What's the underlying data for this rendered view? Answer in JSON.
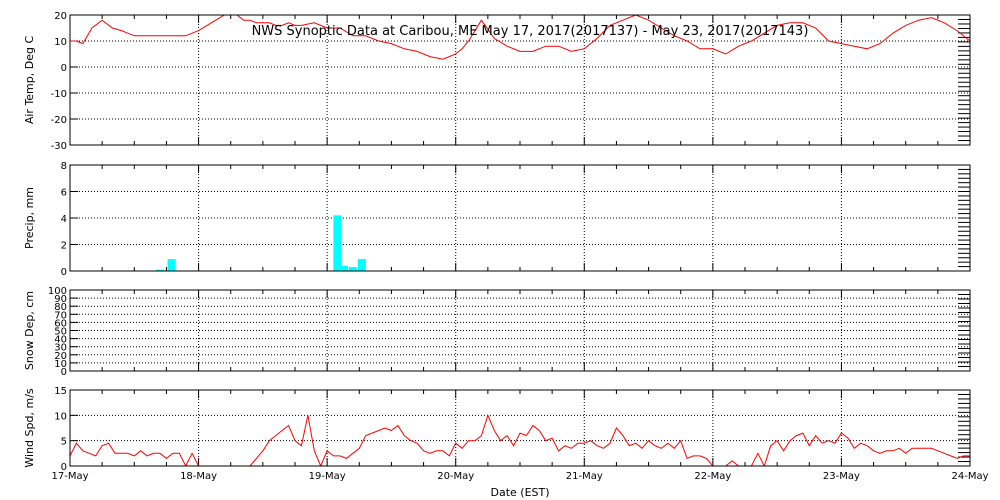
{
  "chart_data": {
    "title": "NWS Synoptic Data at Caribou, ME   May 17, 2017(2017137) - May 23, 2017(2017143)",
    "xlabel": "Date (EST)",
    "x_ticks": [
      "17-May",
      "18-May",
      "19-May",
      "20-May",
      "21-May",
      "22-May",
      "23-May",
      "24-May"
    ],
    "x_range": [
      "2017-05-17 00:00",
      "2017-05-24 00:00"
    ],
    "panels": [
      {
        "id": "air-temp",
        "type": "line",
        "ylabel": "Air Temp, Deg C",
        "ylim": [
          -30,
          20
        ],
        "yticks": [
          -30,
          -20,
          -10,
          0,
          10,
          20
        ],
        "color": "#ff0000",
        "series": [
          {
            "x": [
              0,
              0.05,
              0.1,
              0.17,
              0.25,
              0.33,
              0.4,
              0.5,
              0.6,
              0.75,
              0.9,
              1.0,
              1.1,
              1.2,
              1.3,
              1.35,
              1.4,
              1.45,
              1.5,
              1.55,
              1.6,
              1.65,
              1.7,
              1.75,
              1.8,
              1.9,
              2.0,
              2.1,
              2.2,
              2.3,
              2.4,
              2.5,
              2.6,
              2.7,
              2.8,
              2.9,
              3.0,
              3.05,
              3.1,
              3.15,
              3.2,
              3.3,
              3.4,
              3.5,
              3.6,
              3.7,
              3.8,
              3.9,
              4.0,
              4.1,
              4.2,
              4.3,
              4.4,
              4.5,
              4.6,
              4.7,
              4.8,
              4.9,
              5.0,
              5.1,
              5.2,
              5.3,
              5.4,
              5.5,
              5.6,
              5.7,
              5.8,
              5.9,
              6.0,
              6.1,
              6.2,
              6.3,
              6.4,
              6.5,
              6.6,
              6.7,
              6.8,
              6.9,
              7.0
            ],
            "y": [
              10,
              10,
              9,
              15,
              18,
              15,
              14,
              12,
              12,
              12,
              12,
              14,
              17,
              20,
              20,
              18,
              18,
              17,
              17,
              17,
              16,
              16,
              17,
              16,
              16,
              17,
              15,
              15,
              12,
              12,
              10,
              9,
              7,
              6,
              4,
              3,
              5,
              7,
              10,
              14,
              18,
              11,
              8,
              6,
              6,
              8,
              8,
              6,
              7,
              11,
              16,
              18,
              20,
              18,
              15,
              12,
              10,
              7,
              7,
              5,
              8,
              10,
              13,
              16,
              17,
              17,
              15,
              10,
              9,
              8,
              7,
              9,
              13,
              16,
              18,
              19,
              17,
              14,
              10
            ]
          }
        ]
      },
      {
        "id": "precip",
        "type": "bar",
        "ylabel": "Precip, mm",
        "ylim": [
          0,
          8
        ],
        "yticks": [
          0,
          2,
          4,
          6,
          8
        ],
        "color": "#00ffff",
        "bars": [
          {
            "x": 0.7,
            "value": 0.1
          },
          {
            "x": 0.79,
            "value": 0.9
          },
          {
            "x": 2.08,
            "value": 4.2
          },
          {
            "x": 2.13,
            "value": 0.4
          },
          {
            "x": 2.2,
            "value": 0.3
          },
          {
            "x": 2.27,
            "value": 0.9
          }
        ]
      },
      {
        "id": "snow-dep",
        "type": "line",
        "ylabel": "Snow Dep, cm",
        "ylim": [
          0,
          100
        ],
        "yticks": [
          0,
          10,
          20,
          30,
          40,
          50,
          60,
          70,
          80,
          90,
          100
        ],
        "color": "#ff0000",
        "series": []
      },
      {
        "id": "wind-spd",
        "type": "line",
        "ylabel": "Wind Spd, m/s",
        "ylim": [
          0,
          15
        ],
        "yticks": [
          0,
          5,
          10,
          15
        ],
        "color": "#ff0000",
        "series": [
          {
            "x": [
              0,
              0.05,
              0.1,
              0.15,
              0.2,
              0.25,
              0.3,
              0.35,
              0.4,
              0.45,
              0.5,
              0.55,
              0.6,
              0.65,
              0.7,
              0.75,
              0.8,
              0.85,
              0.9,
              0.95,
              1.0,
              1.05,
              1.1,
              1.15,
              1.2,
              1.25,
              1.3,
              1.35,
              1.4,
              1.45,
              1.5,
              1.55,
              1.6,
              1.65,
              1.7,
              1.75,
              1.8,
              1.85,
              1.9,
              1.95,
              2.0,
              2.05,
              2.1,
              2.15,
              2.2,
              2.25,
              2.3,
              2.35,
              2.4,
              2.45,
              2.5,
              2.55,
              2.6,
              2.65,
              2.7,
              2.75,
              2.8,
              2.85,
              2.9,
              2.95,
              3.0,
              3.05,
              3.1,
              3.15,
              3.2,
              3.25,
              3.3,
              3.35,
              3.4,
              3.45,
              3.5,
              3.55,
              3.6,
              3.65,
              3.7,
              3.75,
              3.8,
              3.85,
              3.9,
              3.95,
              4.0,
              4.05,
              4.1,
              4.15,
              4.2,
              4.25,
              4.3,
              4.35,
              4.4,
              4.45,
              4.5,
              4.55,
              4.6,
              4.65,
              4.7,
              4.75,
              4.8,
              4.85,
              4.9,
              4.95,
              5.0,
              5.05,
              5.1,
              5.15,
              5.2,
              5.25,
              5.3,
              5.35,
              5.4,
              5.45,
              5.5,
              5.55,
              5.6,
              5.65,
              5.7,
              5.75,
              5.8,
              5.85,
              5.9,
              5.95,
              6.0,
              6.05,
              6.1,
              6.15,
              6.2,
              6.25,
              6.3,
              6.35,
              6.4,
              6.45,
              6.5,
              6.55,
              6.6,
              6.65,
              6.7,
              6.75,
              6.8,
              6.85,
              6.9,
              6.95,
              7.0
            ],
            "y": [
              2,
              4.5,
              3,
              2.5,
              2,
              4,
              4.5,
              2.5,
              2.5,
              2.5,
              2,
              3,
              2,
              2.5,
              2.5,
              1.5,
              2.5,
              2.5,
              0,
              2.5,
              0,
              0,
              0,
              0,
              0,
              0,
              0,
              0,
              0,
              1.5,
              3,
              5,
              6,
              7,
              8,
              5,
              4,
              10,
              3,
              0,
              3,
              2,
              2,
              1.5,
              2.5,
              3.5,
              6,
              6.5,
              7,
              7.5,
              7,
              8,
              6,
              5,
              4.5,
              3,
              2.5,
              3,
              3,
              2,
              4.5,
              3.5,
              5,
              5,
              6,
              10,
              7,
              5,
              6,
              4,
              6.5,
              6,
              8,
              7,
              5,
              5.5,
              3,
              4,
              3.5,
              4.5,
              4.5,
              5,
              4,
              3.5,
              4.5,
              7.5,
              6,
              4,
              4.5,
              3.5,
              5,
              4,
              3.5,
              4.5,
              3.5,
              5,
              1.5,
              2,
              2,
              1.5,
              0,
              0,
              0,
              1,
              0,
              0,
              0,
              2.5,
              0,
              4,
              5,
              3,
              5,
              6,
              6.5,
              4,
              6,
              4.5,
              5,
              4.5,
              6.5,
              5.5,
              3.5,
              4.5,
              4,
              3,
              2.5,
              3,
              3,
              3.5,
              2.5,
              3.5,
              3.5,
              3.5,
              3.5,
              3,
              2.5,
              2,
              1.5,
              2,
              2
            ]
          }
        ]
      }
    ]
  }
}
